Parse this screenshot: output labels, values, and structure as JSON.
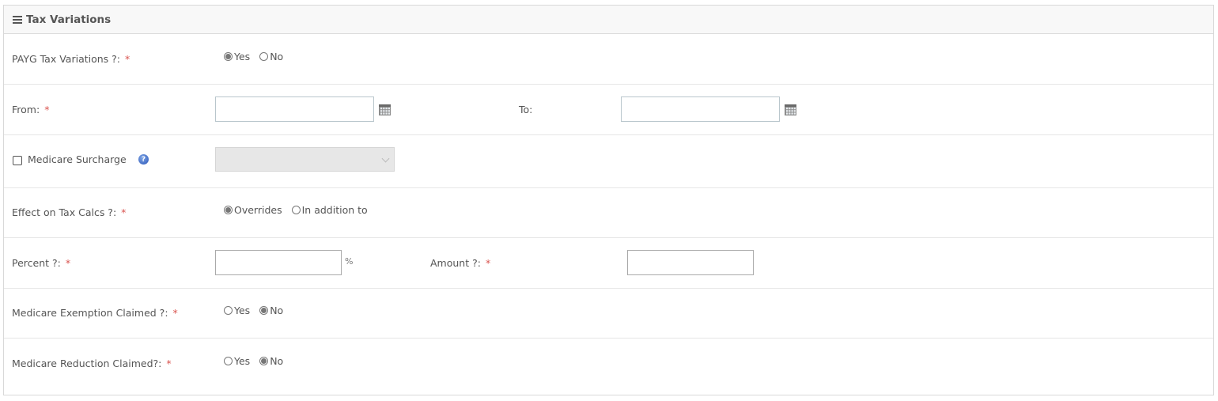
{
  "panel": {
    "title": "Tax Variations",
    "menu_icon": "hamburger-icon"
  },
  "required_marker": "*",
  "payg_tax_variations": {
    "label": "PAYG Tax Variations ?:",
    "options": [
      {
        "label": "Yes",
        "selected": true
      },
      {
        "label": "No",
        "selected": false
      }
    ]
  },
  "dates": {
    "from_label": "From:",
    "from_value": "",
    "to_label": "To:",
    "to_value": "",
    "calendar_icon": "calendar-icon"
  },
  "medicare_surcharge": {
    "label": "Medicare Surcharge",
    "checked": false,
    "help_icon": "help-icon",
    "help_glyph": "?",
    "select_value": "",
    "disabled": true
  },
  "effect_on_tax_calcs": {
    "label": "Effect on Tax Calcs ?:",
    "options": [
      {
        "label": "Overrides",
        "selected": true
      },
      {
        "label": "In addition to",
        "selected": false
      }
    ]
  },
  "percent": {
    "label": "Percent ?:",
    "value": "",
    "unit": "%"
  },
  "amount": {
    "label": "Amount ?:",
    "value": ""
  },
  "medicare_exemption_claimed": {
    "label": "Medicare Exemption Claimed ?:",
    "options": [
      {
        "label": "Yes",
        "selected": false
      },
      {
        "label": "No",
        "selected": true
      }
    ]
  },
  "medicare_reduction_claimed": {
    "label": "Medicare Reduction Claimed?:",
    "options": [
      {
        "label": "Yes",
        "selected": false
      },
      {
        "label": "No",
        "selected": true
      }
    ]
  }
}
